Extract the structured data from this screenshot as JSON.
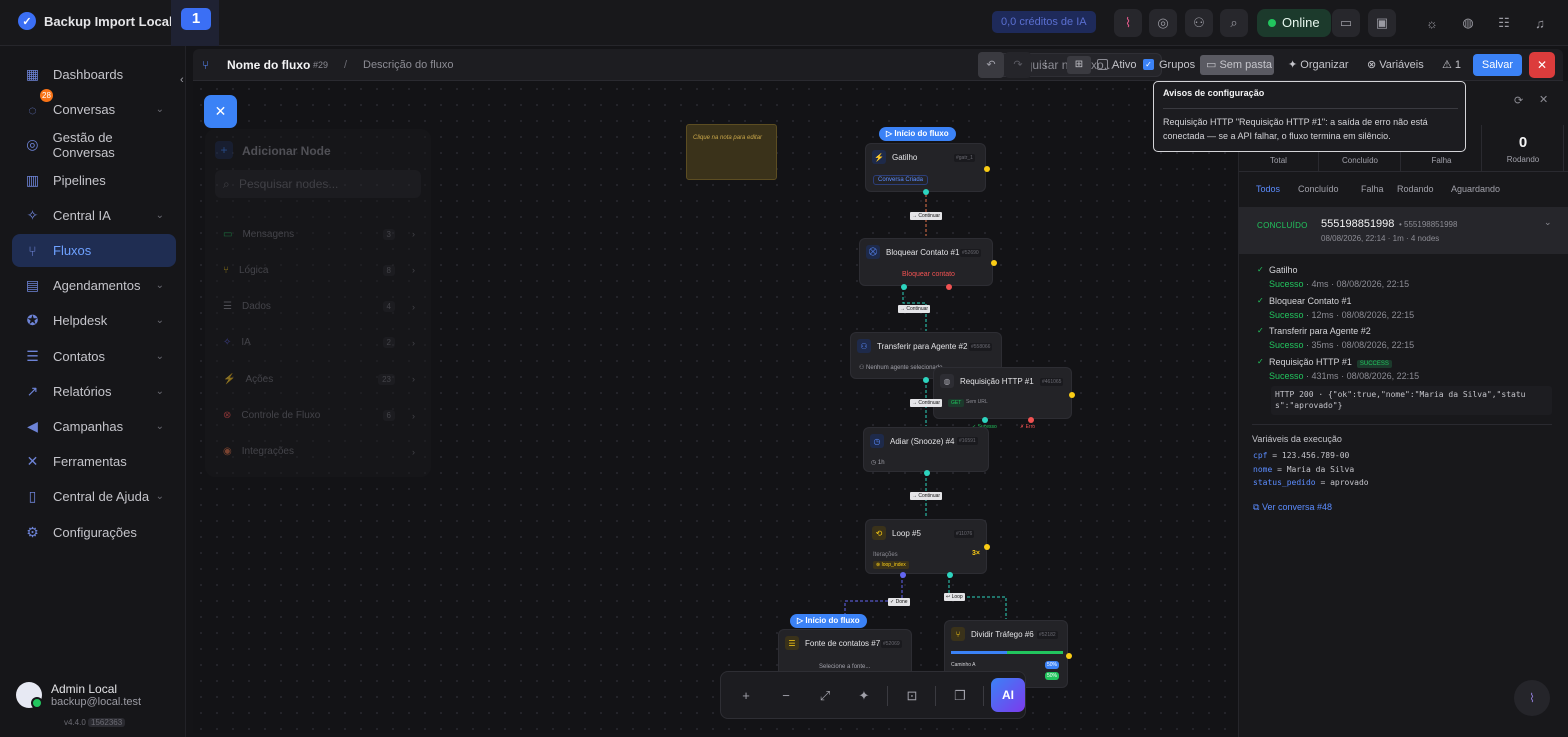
{
  "topbar": {
    "app_title": "Backup Import Local",
    "workspace_number": "1",
    "credits": "0,0 créditos de IA",
    "status": "Online"
  },
  "sidebar": {
    "items": [
      {
        "label": "Dashboards",
        "icon": "grid-icon"
      },
      {
        "label": "Conversas",
        "icon": "chat-icon",
        "badge": "28",
        "chevron": true
      },
      {
        "label": "Gestão de Conversas",
        "icon": "manage-icon"
      },
      {
        "label": "Pipelines",
        "icon": "kanban-icon"
      },
      {
        "label": "Central IA",
        "icon": "ai-icon",
        "chevron": true
      },
      {
        "label": "Fluxos",
        "icon": "flow-icon",
        "active": true
      },
      {
        "label": "Agendamentos",
        "icon": "calendar-icon",
        "chevron": true
      },
      {
        "label": "Helpdesk",
        "icon": "help-icon",
        "chevron": true
      },
      {
        "label": "Contatos",
        "icon": "contacts-icon",
        "chevron": true
      },
      {
        "label": "Relatórios",
        "icon": "chart-icon",
        "chevron": true
      },
      {
        "label": "Campanhas",
        "icon": "megaphone-icon",
        "chevron": true
      },
      {
        "label": "Ferramentas",
        "icon": "tools-icon"
      },
      {
        "label": "Central de Ajuda",
        "icon": "book-icon",
        "chevron": true
      },
      {
        "label": "Configurações",
        "icon": "gear-icon"
      }
    ],
    "user": {
      "name": "Admin Local",
      "email": "backup@local.test"
    },
    "version": "v4.4.0",
    "build": "1562363"
  },
  "editor": {
    "flow_name": "Nome do fluxo",
    "flow_id": "#29",
    "separator": "/",
    "description": "Descrição do fluxo",
    "search_placeholder": "Pesquisar no fluxo...",
    "active_label": "Ativo",
    "groups_label": "Grupos",
    "folder_label": "Sem pasta",
    "organize_label": "Organizar",
    "variables_label": "Variáveis",
    "warnings_count": "1",
    "save_label": "Salvar"
  },
  "palette": {
    "title": "Adicionar Node",
    "search_placeholder": "Pesquisar nodes...",
    "categories": [
      {
        "label": "Mensagens",
        "count": "3"
      },
      {
        "label": "Lógica",
        "count": "8"
      },
      {
        "label": "Dados",
        "count": "4"
      },
      {
        "label": "IA",
        "count": "2"
      },
      {
        "label": "Ações",
        "count": "23"
      },
      {
        "label": "Controle de Fluxo",
        "count": "6"
      },
      {
        "label": "Integrações",
        "count": ""
      }
    ]
  },
  "canvas": {
    "note_text": "Clique na nota para editar",
    "start_label": "Início do fluxo",
    "edge_continue": "→ Continuar",
    "nodes": {
      "gatilho": {
        "title": "Gatilho",
        "id": "#gatr_1",
        "tag": "Conversa Criada"
      },
      "bloquear": {
        "title": "Bloquear Contato #1",
        "id": "#52690",
        "body": "Bloquear contato"
      },
      "transferir": {
        "title": "Transferir para Agente #2",
        "id": "#558066",
        "body": "Nenhum agente selecionado"
      },
      "http": {
        "title": "Requisição HTTP #1",
        "id": "#461065",
        "method": "GET",
        "url": "Sem URL",
        "ok": "✓ Sucesso",
        "err": "✗ Erro"
      },
      "adiar": {
        "title": "Adiar (Snooze) #4",
        "id": "#16591",
        "body": "1h"
      },
      "loop": {
        "title": "Loop #5",
        "id": "#11076",
        "iter_label": "Iterações",
        "iter_value": "3×",
        "var": "loop_index",
        "done": "✓ Done",
        "loop": "↩ Loop"
      },
      "fonte": {
        "title": "Fonte de contatos #7",
        "id": "#52069",
        "body": "Selecione a fonte..."
      },
      "dividir": {
        "title": "Dividir Tráfego #6",
        "id": "#52182",
        "path_a": "Caminho A",
        "pct_a": "50%",
        "pct_b": "50%"
      }
    }
  },
  "warnings_tooltip": {
    "title": "Avisos de configuração",
    "message": "Requisição HTTP \"Requisição HTTP #1\": a saída de erro não está conectada — se a API falhar, o fluxo termina em silêncio."
  },
  "executions": {
    "stats": [
      {
        "value": "",
        "label": "Total"
      },
      {
        "value": "",
        "label": "Concluído"
      },
      {
        "value": "",
        "label": "Falha"
      },
      {
        "value": "0",
        "label": "Rodando"
      }
    ],
    "filters": [
      "Todos",
      "Concluído",
      "Falha",
      "Rodando",
      "Aguardando"
    ],
    "run": {
      "status": "CONCLUÍDO",
      "phone": "555198851998",
      "phone_secondary": "• 555198851998",
      "meta": "08/08/2026, 22:14  · 1m  · 4 nodes"
    },
    "steps": [
      {
        "name": "Gatilho",
        "result": "Sucesso",
        "time": "· 4ms",
        "date": "· 08/08/2026, 22:15"
      },
      {
        "name": "Bloquear Contato #1",
        "result": "Sucesso",
        "time": "· 12ms",
        "date": "· 08/08/2026, 22:15"
      },
      {
        "name": "Transferir para Agente #2",
        "result": "Sucesso",
        "time": "· 35ms",
        "date": "· 08/08/2026, 22:15"
      },
      {
        "name": "Requisição HTTP #1",
        "badge": "SUCCESS",
        "result": "Sucesso",
        "time": "· 431ms",
        "date": "· 08/08/2026, 22:15"
      }
    ],
    "http_response": "HTTP 200 · {\"ok\":true,\"nome\":\"Maria da Silva\",\"status\":\"aprovado\"}",
    "http_response_l1": "HTTP 200 · {\"ok\":true,\"nome\":\"Maria da Silva\",\"statu",
    "http_response_l2": "s\":\"aprovado\"}",
    "vars_title": "Variáveis da execução",
    "vars": [
      {
        "key": "cpf",
        "value": "= 123.456.789-00"
      },
      {
        "key": "nome",
        "value": "= Maria da Silva"
      },
      {
        "key": "status_pedido",
        "value": "= aprovado"
      }
    ],
    "conversation_link": "Ver conversa #48"
  }
}
